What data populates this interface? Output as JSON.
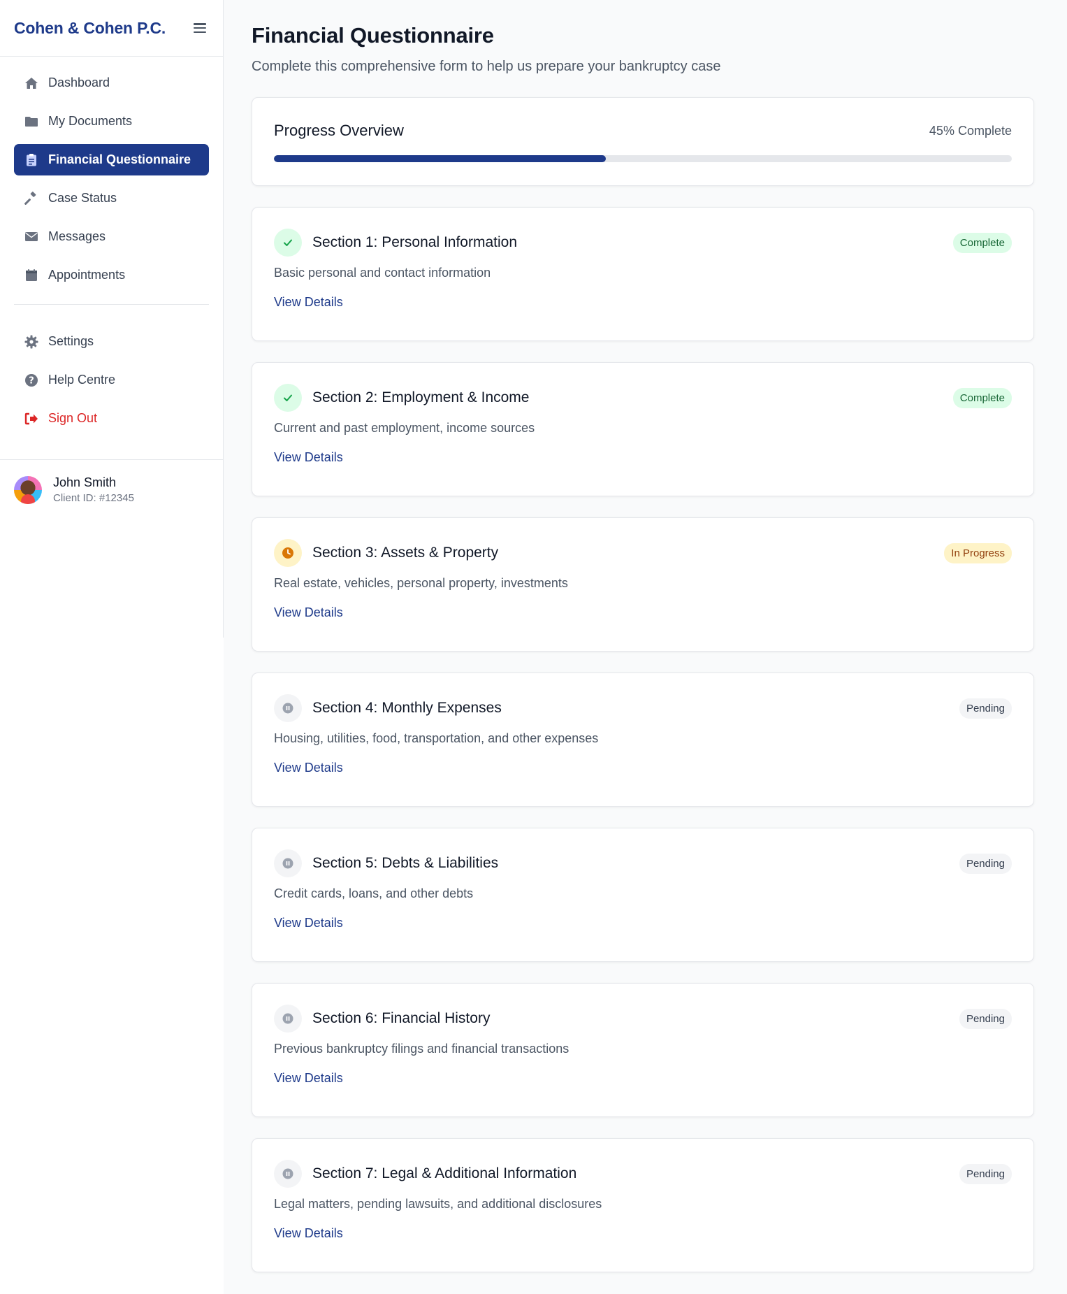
{
  "brand": {
    "name": "Cohen & Cohen P.C."
  },
  "nav": {
    "items": [
      {
        "label": "Dashboard",
        "icon": "home-icon"
      },
      {
        "label": "My Documents",
        "icon": "folder-icon"
      },
      {
        "label": "Financial Questionnaire",
        "icon": "clipboard-icon",
        "active": true
      },
      {
        "label": "Case Status",
        "icon": "gavel-icon"
      },
      {
        "label": "Messages",
        "icon": "envelope-icon"
      },
      {
        "label": "Appointments",
        "icon": "calendar-icon"
      }
    ],
    "secondary": [
      {
        "label": "Settings",
        "icon": "gear-icon"
      },
      {
        "label": "Help Centre",
        "icon": "question-circle-icon"
      },
      {
        "label": "Sign Out",
        "icon": "sign-out-icon"
      }
    ]
  },
  "user": {
    "name": "John Smith",
    "client_id": "Client ID: #12345"
  },
  "page": {
    "title": "Financial Questionnaire",
    "subtitle": "Complete this comprehensive form to help us prepare your bankruptcy case"
  },
  "progress": {
    "title": "Progress Overview",
    "label": "45% Complete",
    "value": 45
  },
  "colors": {
    "brand": "#1e3a8a",
    "complete": "#16a34a",
    "in_progress": "#d97706",
    "pending": "#9ca3af",
    "danger": "#dc2626"
  },
  "sections": [
    {
      "title": "Section 1: Personal Information",
      "description": "Basic personal and contact information",
      "status": "Complete",
      "state": "complete",
      "link": "View Details"
    },
    {
      "title": "Section 2: Employment & Income",
      "description": "Current and past employment, income sources",
      "status": "Complete",
      "state": "complete",
      "link": "View Details"
    },
    {
      "title": "Section 3: Assets & Property",
      "description": "Real estate, vehicles, personal property, investments",
      "status": "In Progress",
      "state": "progress",
      "link": "View Details"
    },
    {
      "title": "Section 4: Monthly Expenses",
      "description": "Housing, utilities, food, transportation, and other expenses",
      "status": "Pending",
      "state": "pending",
      "link": "View Details"
    },
    {
      "title": "Section 5: Debts & Liabilities",
      "description": "Credit cards, loans, and other debts",
      "status": "Pending",
      "state": "pending",
      "link": "View Details"
    },
    {
      "title": "Section 6: Financial History",
      "description": "Previous bankruptcy filings and financial transactions",
      "status": "Pending",
      "state": "pending",
      "link": "View Details"
    },
    {
      "title": "Section 7: Legal & Additional Information",
      "description": "Legal matters, pending lawsuits, and additional disclosures",
      "status": "Pending",
      "state": "pending",
      "link": "View Details"
    }
  ]
}
